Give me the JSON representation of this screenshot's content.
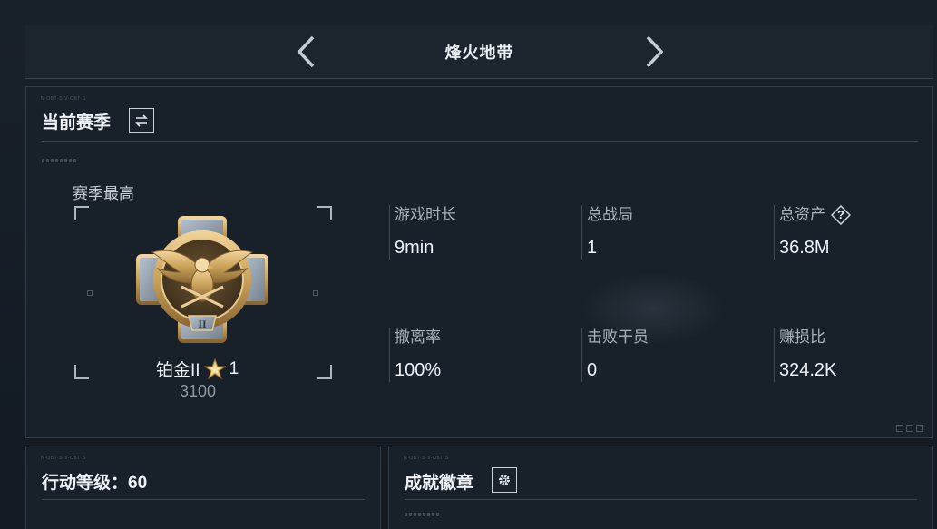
{
  "header": {
    "title": "烽火地带"
  },
  "current_season": {
    "micro_text": "N·OBT·S·V-OBT·S",
    "heading": "当前赛季",
    "season_best_label": "赛季最高",
    "rank": {
      "name": "铂金II",
      "stars": "1",
      "score": "3100",
      "emblem_numeral": "II"
    },
    "stats": [
      {
        "label": "游戏时长",
        "value": "9min"
      },
      {
        "label": "总战局",
        "value": "1"
      },
      {
        "label": "总资产",
        "value": "36.8M",
        "help": "?"
      },
      {
        "label": "撤离率",
        "value": "100%"
      },
      {
        "label": "击败干员",
        "value": "0"
      },
      {
        "label": "赚损比",
        "value": "324.2K"
      }
    ]
  },
  "action_level": {
    "micro_text": "N·OBT·S·V-OBT·S",
    "heading": "行动等级：60"
  },
  "achievement_badges": {
    "micro_text": "N·OBT·S·V-OBT·S",
    "heading": "成就徽章"
  },
  "colors": {
    "background": "#151b22",
    "panel": "#182029",
    "accent_gold": "#c9a25a"
  },
  "icons": {
    "prev": "chevron-left-icon",
    "next": "chevron-right-icon",
    "swap": "swap-icon",
    "settings": "gear-icon",
    "help": "question-icon",
    "star": "star-icon"
  }
}
